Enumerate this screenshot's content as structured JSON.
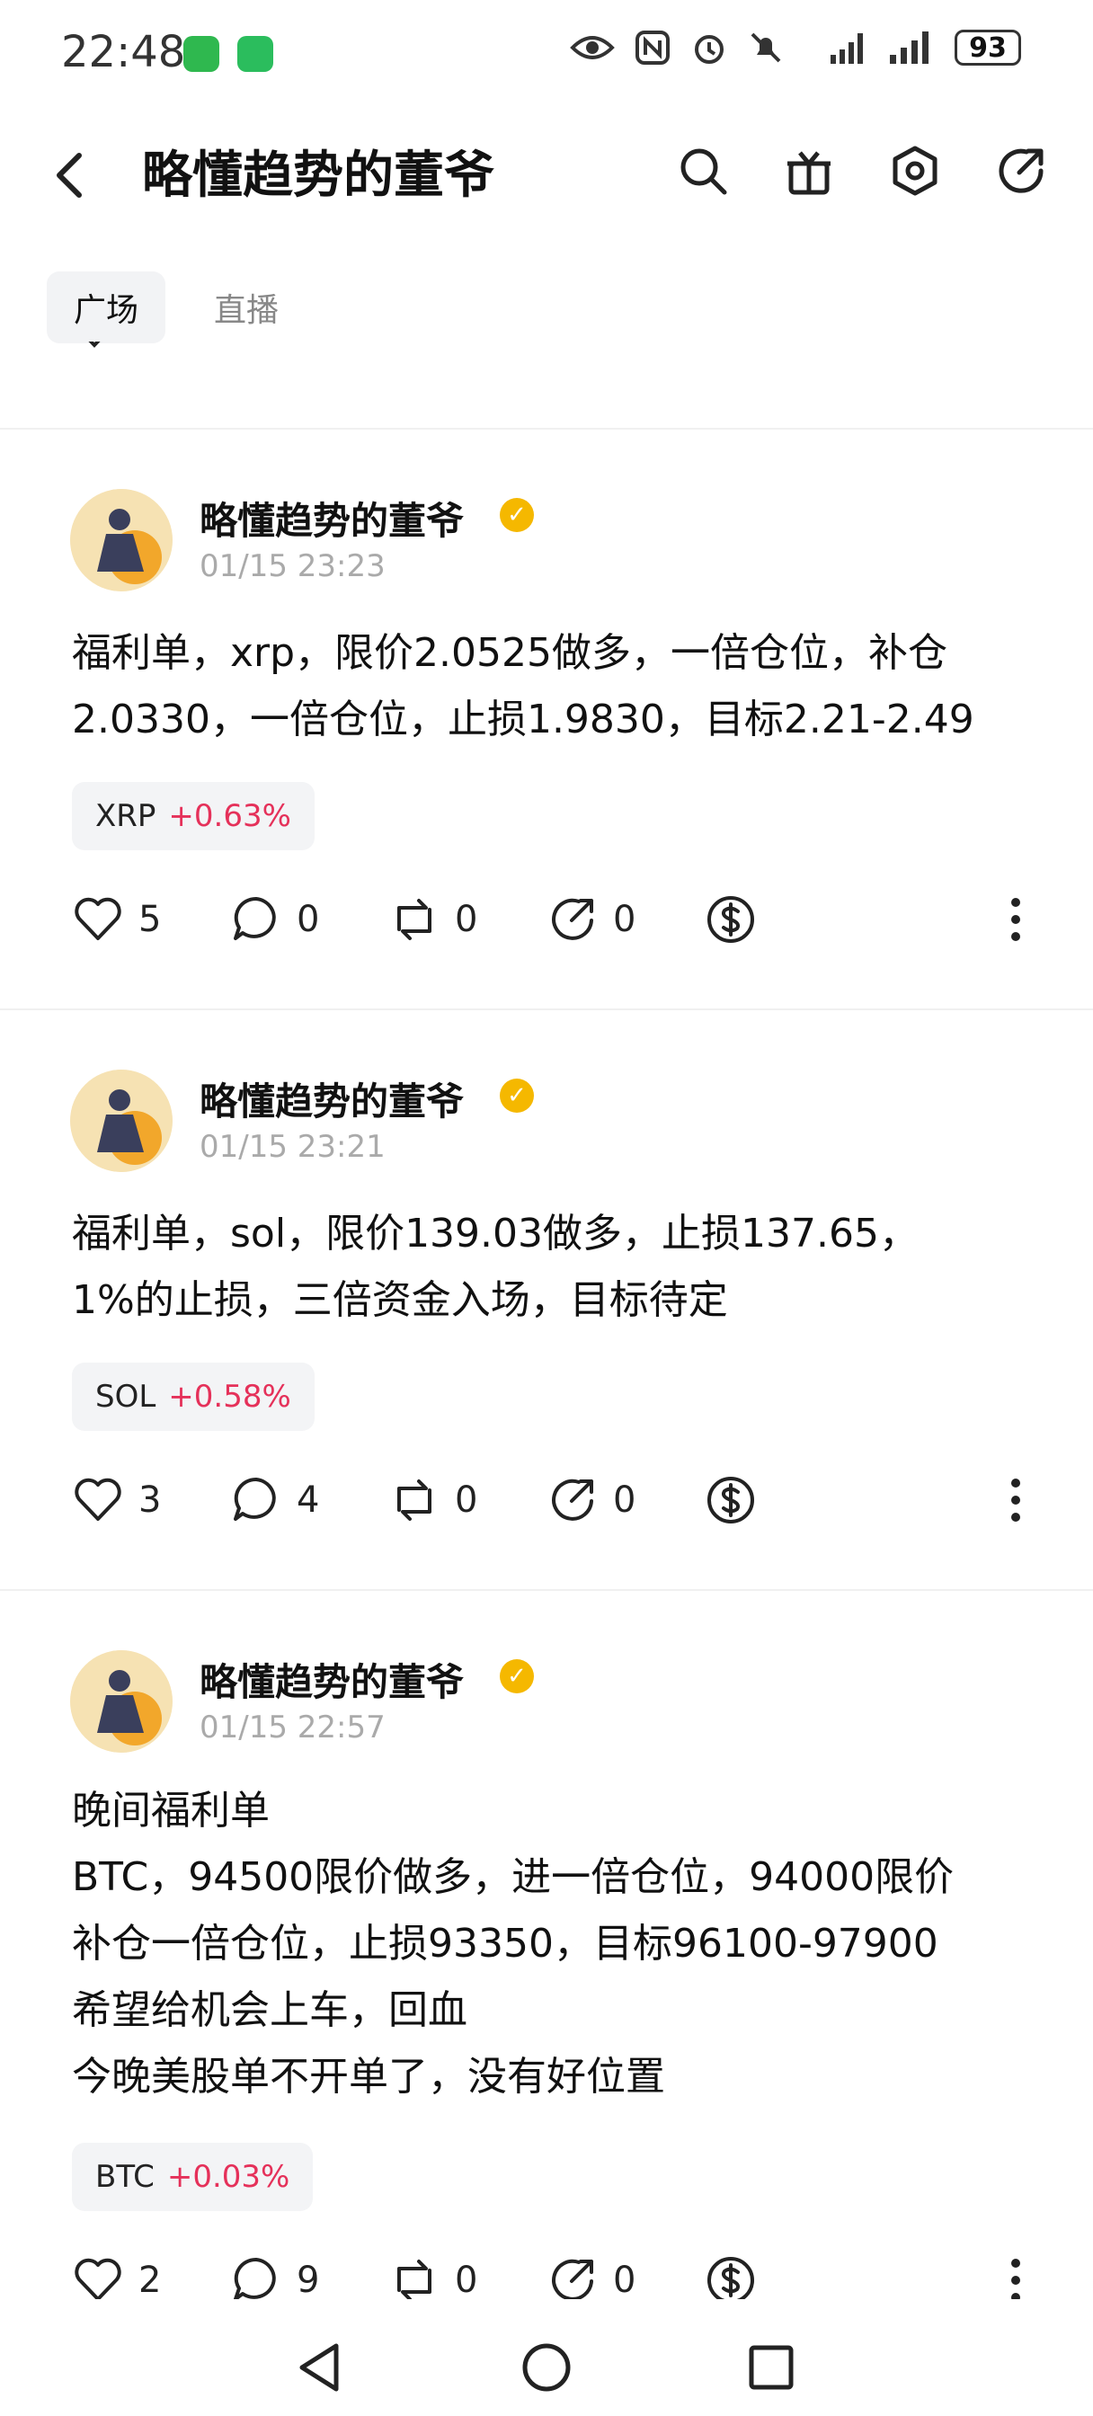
{
  "status": {
    "time": "22:48",
    "battery": "93"
  },
  "header": {
    "title": "略懂趋势的董爷"
  },
  "tabs": [
    {
      "label": "广场"
    },
    {
      "label": "直播"
    }
  ],
  "posts": [
    {
      "author": "略懂趋势的董爷",
      "time": "01/15 23:23",
      "content": "福利单，xrp，限价2.0525做多，一倍仓位，补仓\n2.0330，一倍仓位，止损1.9830，目标2.21-2.49",
      "tag": {
        "symbol": "XRP",
        "change": "+0.63%"
      },
      "stats": {
        "likes": "5",
        "comments": "0",
        "reposts": "0",
        "shares": "0"
      }
    },
    {
      "author": "略懂趋势的董爷",
      "time": "01/15 23:21",
      "content": "福利单，sol，限价139.03做多，止损137.65，\n1%的止损，三倍资金入场，目标待定",
      "tag": {
        "symbol": "SOL",
        "change": "+0.58%"
      },
      "stats": {
        "likes": "3",
        "comments": "4",
        "reposts": "0",
        "shares": "0"
      }
    },
    {
      "author": "略懂趋势的董爷",
      "time": "01/15 22:57",
      "content": "晚间福利单\nBTC，94500限价做多，进一倍仓位，94000限价\n补仓一倍仓位，止损93350，目标96100-97900\n希望给机会上车，回血\n今晚美股单不开单了，没有好位置",
      "tag": {
        "symbol": "BTC",
        "change": "+0.03%"
      },
      "stats": {
        "likes": "2",
        "comments": "9",
        "reposts": "0",
        "shares": "0"
      }
    }
  ],
  "colors": {
    "accent_red": "#e5315a",
    "verified_gold": "#f5b800"
  }
}
